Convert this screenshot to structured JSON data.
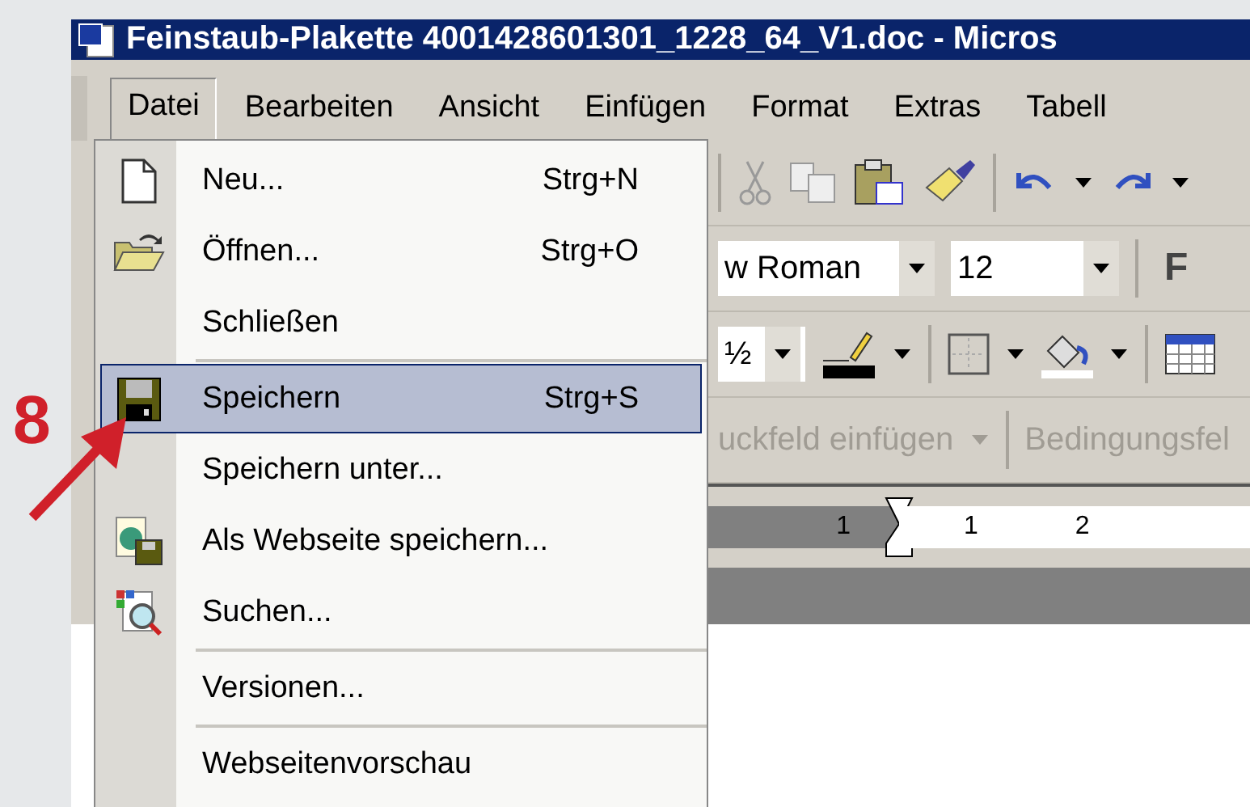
{
  "window": {
    "title": "Feinstaub-Plakette 4001428601301_1228_64_V1.doc - Micros"
  },
  "menu_bar": [
    {
      "label": "Datei",
      "selected": true
    },
    {
      "label": "Bearbeiten",
      "selected": false
    },
    {
      "label": "Ansicht",
      "selected": false
    },
    {
      "label": "Einfügen",
      "selected": false
    },
    {
      "label": "Format",
      "selected": false
    },
    {
      "label": "Extras",
      "selected": false
    },
    {
      "label": "Tabell",
      "selected": false
    }
  ],
  "file_menu": [
    {
      "kind": "new",
      "label": "Neu...",
      "shortcut": "Strg+N",
      "selected": false,
      "separator_before": false
    },
    {
      "kind": "open",
      "label": "Öffnen...",
      "shortcut": "Strg+O",
      "selected": false,
      "separator_before": false
    },
    {
      "kind": "plain",
      "label": "Schließen",
      "selected": false,
      "separator_before": false
    },
    {
      "kind": "save",
      "label": "Speichern",
      "shortcut": "Strg+S",
      "selected": true,
      "separator_before": true
    },
    {
      "kind": "plain",
      "label": "Speichern unter...",
      "selected": false,
      "separator_before": false
    },
    {
      "kind": "web-save",
      "label": "Als Webseite speichern...",
      "selected": false,
      "separator_before": false
    },
    {
      "kind": "search",
      "label": "Suchen...",
      "selected": false,
      "separator_before": false
    },
    {
      "kind": "plain",
      "label": "Versionen...",
      "selected": false,
      "separator_before": true
    },
    {
      "kind": "plain",
      "label": "Webseitenvorschau",
      "selected": false,
      "separator_before": true
    }
  ],
  "toolbar": {
    "font_name": "w Roman",
    "font_size": "12",
    "bold_button": "F",
    "line_style": "½",
    "mail_merge": [
      "uckfeld einfügen",
      "Bedingungsfel"
    ]
  },
  "ruler": {
    "numbers": [
      "1",
      "1",
      "2"
    ]
  },
  "annotation": {
    "label": "8"
  }
}
